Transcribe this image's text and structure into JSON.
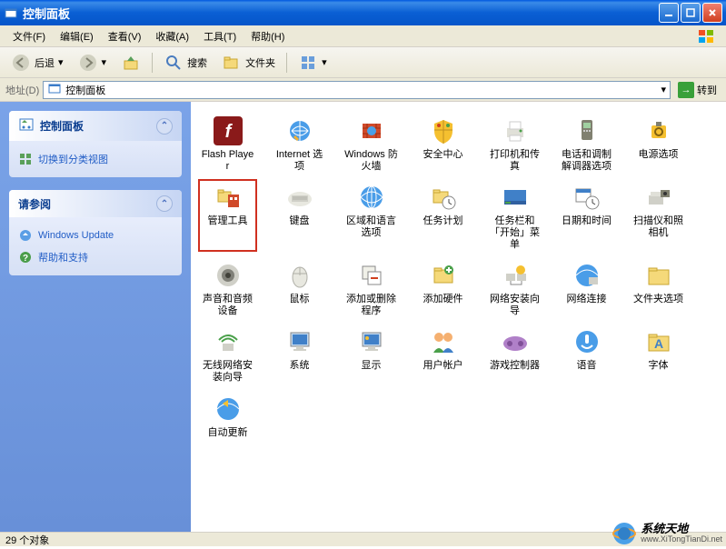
{
  "window": {
    "title": "控制面板"
  },
  "menu": {
    "file": "文件(F)",
    "edit": "编辑(E)",
    "view": "查看(V)",
    "favorites": "收藏(A)",
    "tools": "工具(T)",
    "help": "帮助(H)"
  },
  "toolbar": {
    "back": "后退",
    "search": "搜索",
    "folders": "文件夹"
  },
  "address": {
    "label": "地址(D)",
    "value": "控制面板",
    "go": "转到"
  },
  "sidebar": {
    "panel1": {
      "title": "控制面板",
      "switch_view": "切换到分类视图"
    },
    "panel2": {
      "title": "请参阅",
      "link1": "Windows Update",
      "link2": "帮助和支持"
    }
  },
  "items": [
    {
      "label": "Flash Player",
      "icon": "flash"
    },
    {
      "label": "Internet 选项",
      "icon": "inet"
    },
    {
      "label": "Windows 防火墙",
      "icon": "firewall"
    },
    {
      "label": "安全中心",
      "icon": "shield"
    },
    {
      "label": "打印机和传真",
      "icon": "printer"
    },
    {
      "label": "电话和调制解调器选项",
      "icon": "phone"
    },
    {
      "label": "电源选项",
      "icon": "power"
    },
    {
      "label": "管理工具",
      "icon": "admin",
      "highlighted": true
    },
    {
      "label": "键盘",
      "icon": "keyboard"
    },
    {
      "label": "区域和语言选项",
      "icon": "globe"
    },
    {
      "label": "任务计划",
      "icon": "sched"
    },
    {
      "label": "任务栏和「开始」菜单",
      "icon": "taskbar"
    },
    {
      "label": "日期和时间",
      "icon": "datetime"
    },
    {
      "label": "扫描仪和照相机",
      "icon": "scanner"
    },
    {
      "label": "声音和音频设备",
      "icon": "sound"
    },
    {
      "label": "鼠标",
      "icon": "mouse"
    },
    {
      "label": "添加或删除程序",
      "icon": "addremove"
    },
    {
      "label": "添加硬件",
      "icon": "addhw"
    },
    {
      "label": "网络安装向导",
      "icon": "netwiz"
    },
    {
      "label": "网络连接",
      "icon": "netconn"
    },
    {
      "label": "文件夹选项",
      "icon": "folderopt"
    },
    {
      "label": "无线网络安装向导",
      "icon": "wireless"
    },
    {
      "label": "系统",
      "icon": "system"
    },
    {
      "label": "显示",
      "icon": "display"
    },
    {
      "label": "用户帐户",
      "icon": "users"
    },
    {
      "label": "游戏控制器",
      "icon": "game"
    },
    {
      "label": "语音",
      "icon": "speech"
    },
    {
      "label": "字体",
      "icon": "fonts"
    },
    {
      "label": "自动更新",
      "icon": "update"
    }
  ],
  "status": {
    "text": "29 个对象"
  },
  "watermark": {
    "name": "系统天地",
    "url": "www.XiTongTianDi.net"
  }
}
